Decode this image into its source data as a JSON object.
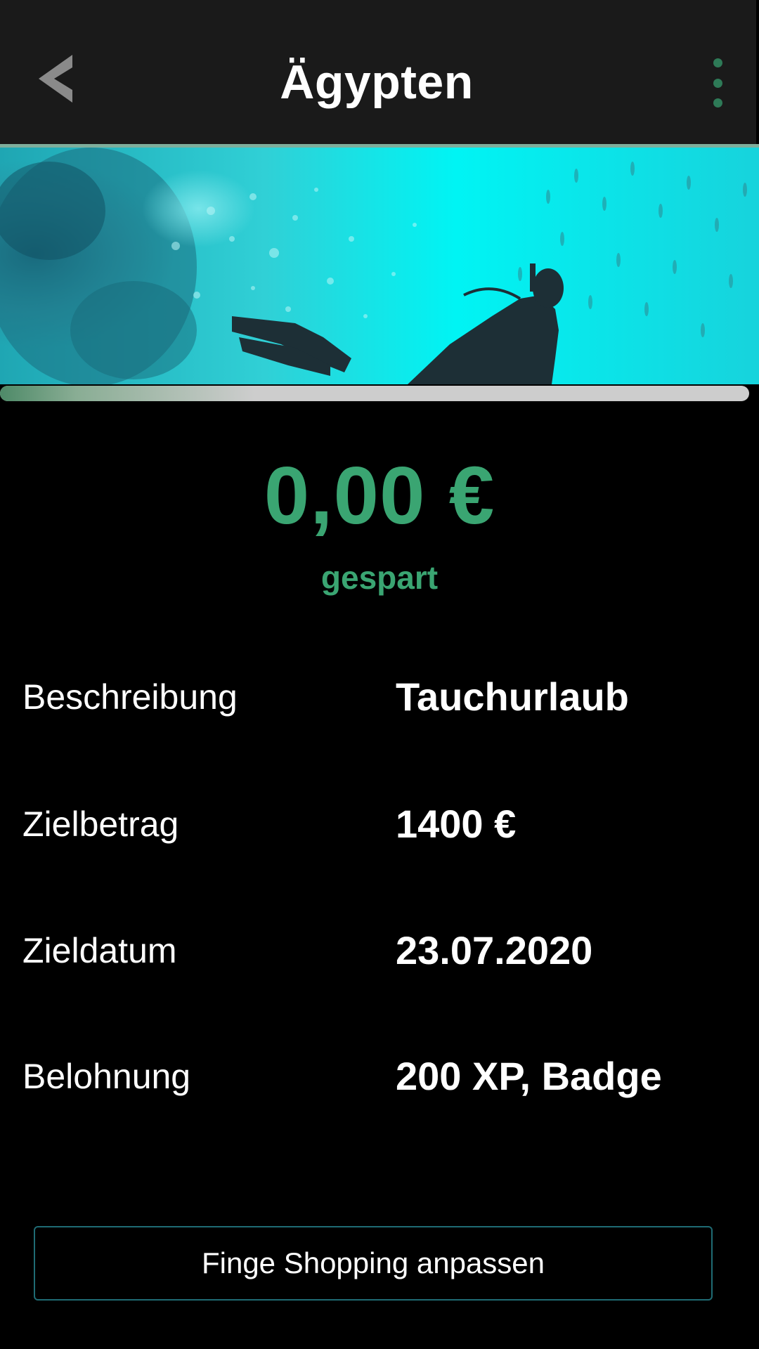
{
  "header": {
    "title": "Ägypten",
    "back_icon": "chevron-left-icon",
    "menu_icon": "more-vertical-icon"
  },
  "hero": {
    "image": "underwater-scuba-diver-photo"
  },
  "progress": {
    "fraction": 0.0
  },
  "savings": {
    "amount": "0,00 €",
    "label": "gespart"
  },
  "details": [
    {
      "label": "Beschreibung",
      "value": "Tauchurlaub"
    },
    {
      "label": "Zielbetrag",
      "value": "1400 €"
    },
    {
      "label": "Zieldatum",
      "value": "23.07.2020"
    },
    {
      "label": "Belohnung",
      "value": "200 XP, Badge"
    }
  ],
  "actions": {
    "edit_label": "Finge Shopping anpassen"
  },
  "colors": {
    "accent": "#3aa572",
    "header_bg": "#1a1a1a",
    "background": "#000000",
    "button_border": "#1f6b74"
  }
}
